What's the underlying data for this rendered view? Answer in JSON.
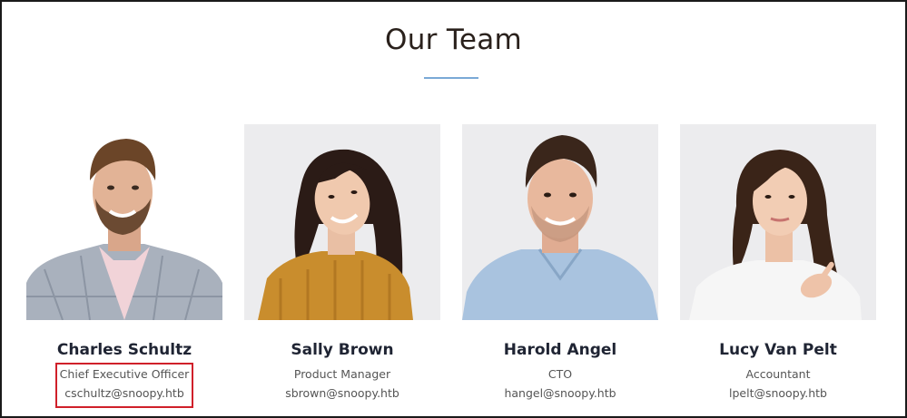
{
  "section": {
    "title": "Our Team"
  },
  "team": [
    {
      "name": "Charles Schultz",
      "role": "Chief Executive Officer",
      "email": "cschultz@snoopy.htb"
    },
    {
      "name": "Sally Brown",
      "role": "Product Manager",
      "email": "sbrown@snoopy.htb"
    },
    {
      "name": "Harold Angel",
      "role": "CTO",
      "email": "hangel@snoopy.htb"
    },
    {
      "name": "Lucy Van Pelt",
      "role": "Accountant",
      "email": "lpelt@snoopy.htb"
    }
  ],
  "colors": {
    "accent_rule": "#7aa9d6",
    "highlight": "#d0202a",
    "heading": "#2a211c"
  }
}
